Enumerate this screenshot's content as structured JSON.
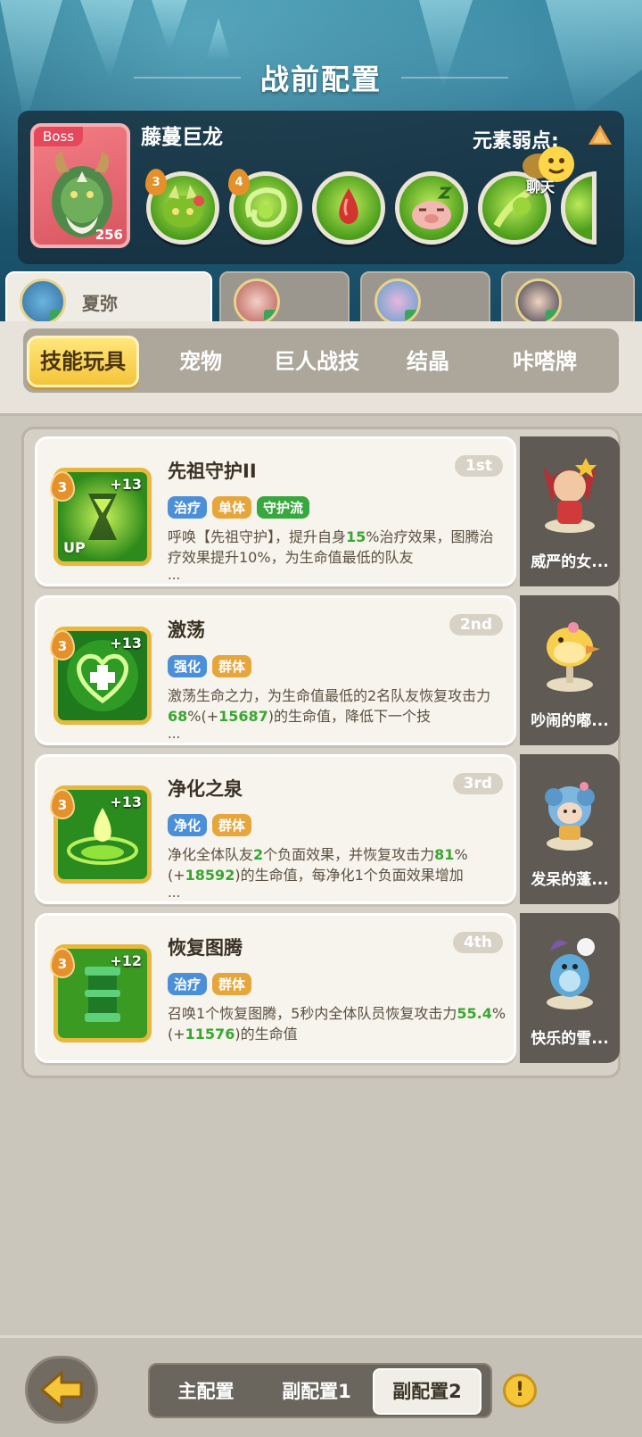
{
  "header": {
    "title": "战前配置"
  },
  "boss": {
    "tag": "Boss",
    "level": "256",
    "name": "藤蔓巨龙",
    "weakness_label": "元素弱点:",
    "skills": [
      {
        "icon": "thorn-face-icon",
        "level": "3"
      },
      {
        "icon": "green-swirl-icon",
        "level": "4"
      },
      {
        "icon": "blood-drop-icon",
        "level": ""
      },
      {
        "icon": "sleeping-pig-icon",
        "level": ""
      },
      {
        "icon": "green-vine-icon",
        "level": ""
      }
    ],
    "chat_label": "聊天"
  },
  "heroes": [
    {
      "name": "夏弥",
      "active": true
    },
    {
      "name": "",
      "active": false
    },
    {
      "name": "",
      "active": false
    },
    {
      "name": "",
      "active": false
    }
  ],
  "categories": [
    "技能玩具",
    "宠物",
    "巨人战技",
    "结晶",
    "咔嗒牌"
  ],
  "active_category": "技能玩具",
  "skills": [
    {
      "level": "3",
      "plus": "+13",
      "up": "UP",
      "name": "先祖守护II",
      "rank": "1st",
      "tags": [
        "治疗",
        "单体",
        "守护流"
      ],
      "desc_1": "呼唤【先祖守护】，提升自身",
      "desc_hl_1": "15",
      "desc_2": "%治疗效果，图腾治疗效果提升10%，为生命值最低的队友",
      "ellipsis": "...",
      "pet": "威严的女..."
    },
    {
      "level": "3",
      "plus": "+13",
      "up": "",
      "name": "激荡",
      "rank": "2nd",
      "tags": [
        "强化",
        "群体"
      ],
      "desc_1": "激荡生命之力，为生命值最低的2名队友恢复攻击力",
      "desc_hl_1": "68",
      "desc_2": "%(+",
      "desc_hl_2": "15687",
      "desc_3": ")的生命值，降低下一个技",
      "ellipsis": "...",
      "pet": "吵闹的嘟..."
    },
    {
      "level": "3",
      "plus": "+13",
      "up": "",
      "name": "净化之泉",
      "rank": "3rd",
      "tags": [
        "净化",
        "群体"
      ],
      "desc_1": "净化全体队友",
      "desc_hl_1": "2",
      "desc_2": "个负面效果，并恢复攻击力",
      "desc_hl_2": "81",
      "desc_3": "%(+",
      "desc_hl_3": "18592",
      "desc_4": ")的生命值，每净化1个负面效果增加",
      "ellipsis": "...",
      "pet": "发呆的蓬..."
    },
    {
      "level": "3",
      "plus": "+12",
      "up": "",
      "name": "恢复图腾",
      "rank": "4th",
      "tags": [
        "治疗",
        "群体"
      ],
      "desc_1": "召唤1个恢复图腾，5秒内全体队员恢复攻击力",
      "desc_hl_1": "55.4",
      "desc_2": "%(+",
      "desc_hl_2": "11576",
      "desc_3": ")的生命值",
      "ellipsis": "",
      "pet": "快乐的雪..."
    }
  ],
  "presets": [
    "主配置",
    "副配置1",
    "副配置2"
  ],
  "active_preset": "副配置2",
  "info_icon": "!",
  "colors": {
    "accent": "#f4c43a",
    "heal_tag": "#4a8fd8",
    "target_tag": "#e6a63c",
    "style_tag": "#37a83d",
    "highlight": "#3aa632"
  }
}
